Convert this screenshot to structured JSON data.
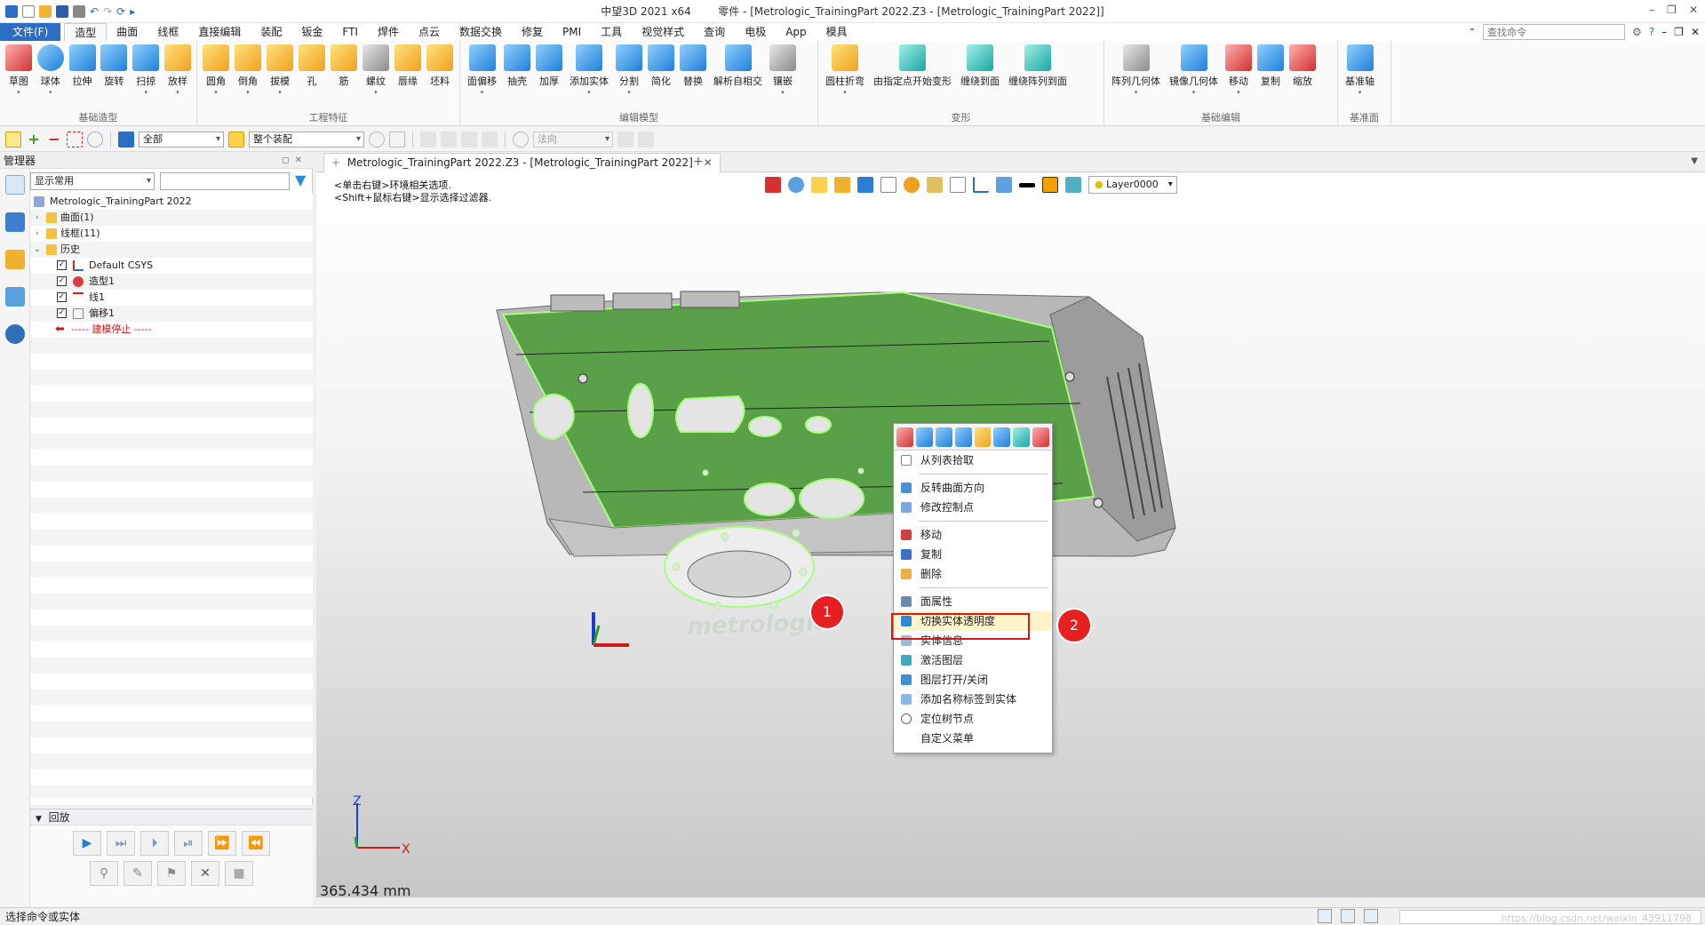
{
  "window": {
    "title": "中望3D 2021 x64",
    "doc_title": "零件 - [Metrologic_TrainingPart  2022.Z3 - [Metrologic_TrainingPart  2022]]"
  },
  "menu": {
    "file": "文件(F)",
    "items": [
      "造型",
      "曲面",
      "线框",
      "直接编辑",
      "装配",
      "钣金",
      "FTI",
      "焊件",
      "点云",
      "数据交换",
      "修复",
      "PMI",
      "工具",
      "视觉样式",
      "查询",
      "电极",
      "App",
      "模具"
    ],
    "search_placeholder": "查找命令"
  },
  "ribbon": {
    "groups": [
      {
        "label": "基础造型",
        "tools": [
          "草图",
          "球体",
          "拉伸",
          "旋转",
          "扫掠",
          "放样"
        ]
      },
      {
        "label": "工程特征",
        "tools": [
          "圆角",
          "倒角",
          "拔模",
          "孔",
          "筋",
          "螺纹",
          "唇缘",
          "坯料"
        ]
      },
      {
        "label": "编辑模型",
        "tools": [
          "面偏移",
          "抽壳",
          "加厚",
          "添加实体",
          "分割",
          "简化",
          "替换",
          "解析自相交",
          "镶嵌"
        ]
      },
      {
        "label": "变形",
        "tools": [
          "圆柱折弯",
          "由指定点开始变形",
          "缠绕到面",
          "缠绕阵列到面"
        ]
      },
      {
        "label": "基础编辑",
        "tools": [
          "阵列几何体",
          "镜像几何体",
          "移动",
          "复制",
          "缩放"
        ]
      },
      {
        "label": "基准面",
        "tools": [
          "基准轴"
        ]
      }
    ]
  },
  "toolbar2": {
    "filter": "全部",
    "scope": "整个装配",
    "direction": "法向"
  },
  "manager": {
    "title": "管理器",
    "display_mode": "显示常用",
    "tree": {
      "root": "Metrologic_TrainingPart  2022",
      "surfaces": "曲面(1)",
      "wireframe": "线框(11)",
      "history": "历史",
      "history_items": [
        "Default CSYS",
        "造型1",
        "线1",
        "偏移1"
      ],
      "stop_marker": "----- 建模停止 -----"
    }
  },
  "playback": {
    "title": "回放"
  },
  "document": {
    "tab": "Metrologic_TrainingPart  2022.Z3 - [Metrologic_TrainingPart  2022]",
    "hint1": "<单击右键>环境相关选项.",
    "hint2": "<Shift+鼠标右键>显示选择过滤器.",
    "layer": "Layer0000",
    "measure": "365.434 mm",
    "part_text": "metrologic"
  },
  "context_menu": {
    "items": [
      "从列表拾取",
      "反转曲面方向",
      "修改控制点",
      "移动",
      "复制",
      "删除",
      "面属性",
      "切换实体透明度",
      "实体信息",
      "激活图层",
      "图层打开/关闭",
      "添加名称标签到实体",
      "定位树节点",
      "自定义菜单"
    ]
  },
  "callouts": [
    "1",
    "2"
  ],
  "status": {
    "text": "选择命令或实体",
    "watermark": "https://blog.csdn.net/weixin_43911798"
  },
  "colors": {
    "accent": "#2b6cc4",
    "part_green": "#5aa048",
    "highlight_edge": "#a6ff7a",
    "callout_red": "#e62020"
  }
}
